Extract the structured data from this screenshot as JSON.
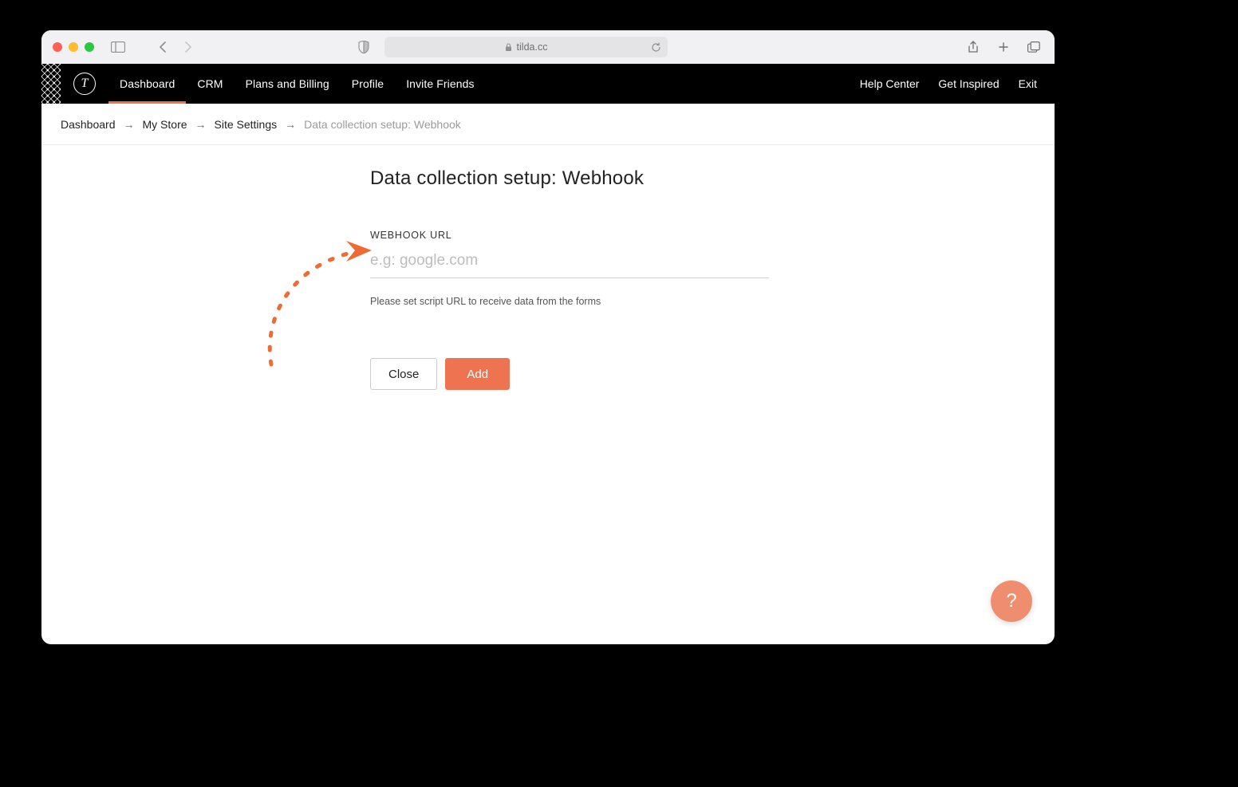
{
  "browser": {
    "url_host": "tilda.cc"
  },
  "header": {
    "logo_glyph": "T",
    "nav": [
      {
        "label": "Dashboard",
        "active": true
      },
      {
        "label": "CRM"
      },
      {
        "label": "Plans and Billing"
      },
      {
        "label": "Profile"
      },
      {
        "label": "Invite Friends"
      }
    ],
    "right": {
      "help_center": "Help Center",
      "get_inspired": "Get Inspired",
      "exit": "Exit"
    }
  },
  "breadcrumb": {
    "items": [
      "Dashboard",
      "My Store",
      "Site Settings"
    ],
    "current": "Data collection setup: Webhook"
  },
  "page": {
    "title": "Data collection setup: Webhook",
    "webhook": {
      "label": "WEBHOOK URL",
      "placeholder": "e.g: google.com",
      "value": "",
      "help": "Please set script URL to receive data from the forms"
    },
    "buttons": {
      "close": "Close",
      "add": "Add"
    }
  },
  "help_fab": "?",
  "colors": {
    "accent": "#ee7350",
    "accent_light": "#ee8e6e"
  }
}
